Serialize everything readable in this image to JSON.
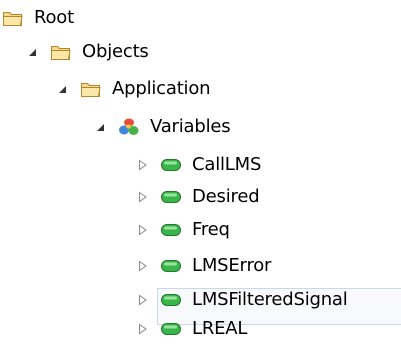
{
  "tree": {
    "root": {
      "label": "Root",
      "icon": "folder-icon"
    },
    "objects": {
      "label": "Objects",
      "icon": "folder-icon",
      "expanded": true
    },
    "application": {
      "label": "Application",
      "icon": "folder-icon",
      "expanded": true
    },
    "variables": {
      "label": "Variables",
      "icon": "variables-icon",
      "expanded": true
    },
    "items": [
      {
        "label": "CallLMS",
        "icon": "variable-icon"
      },
      {
        "label": "Desired",
        "icon": "variable-icon"
      },
      {
        "label": "Freq",
        "icon": "variable-icon"
      },
      {
        "label": "LMSError",
        "icon": "variable-icon"
      },
      {
        "label": "LMSFilteredSignal",
        "icon": "variable-icon"
      },
      {
        "label": "LREAL",
        "icon": "variable-icon",
        "selected": true
      }
    ]
  },
  "colors": {
    "folder": "#e8b94a",
    "variable": "#3ab54a",
    "selection_border": "#c9d7ea"
  }
}
